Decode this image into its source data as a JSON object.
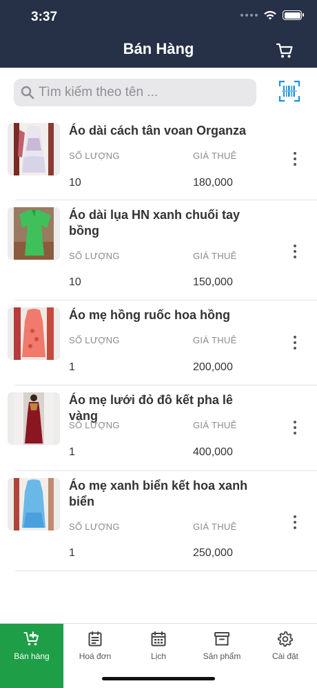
{
  "status": {
    "time": "3:37"
  },
  "header": {
    "title": "Bán Hàng"
  },
  "search": {
    "placeholder": "Tìm kiếm theo tên ..."
  },
  "list": {
    "qty_label": "SỐ LƯỢNG",
    "price_label": "GIÁ THUÊ",
    "items": [
      {
        "name": "Áo dài cách tân voan Organza",
        "qty": "10",
        "price": "180,000"
      },
      {
        "name": "Áo dài lụa HN xanh chuối tay bồng",
        "qty": "10",
        "price": "150,000"
      },
      {
        "name": "Áo mẹ hồng ruốc hoa hồng",
        "qty": "1",
        "price": "200,000"
      },
      {
        "name": "Áo mẹ lưới đỏ đô kết pha lê vàng",
        "qty": "1",
        "price": "400,000"
      },
      {
        "name": "Áo mẹ xanh biển kết hoa xanh biển",
        "qty": "1",
        "price": "250,000"
      }
    ]
  },
  "tabs": [
    {
      "label": "Bán hàng",
      "icon": "cart-plus-icon",
      "active": true
    },
    {
      "label": "Hoá đơn",
      "icon": "invoice-icon",
      "active": false
    },
    {
      "label": "Lịch",
      "icon": "calendar-icon",
      "active": false
    },
    {
      "label": "Sản phẩm",
      "icon": "archive-box-icon",
      "active": false
    },
    {
      "label": "Cài đặt",
      "icon": "gear-icon",
      "active": false
    }
  ],
  "colors": {
    "header": "#263046",
    "accent": "#1e9e47",
    "barcode": "#1a8fe3"
  }
}
